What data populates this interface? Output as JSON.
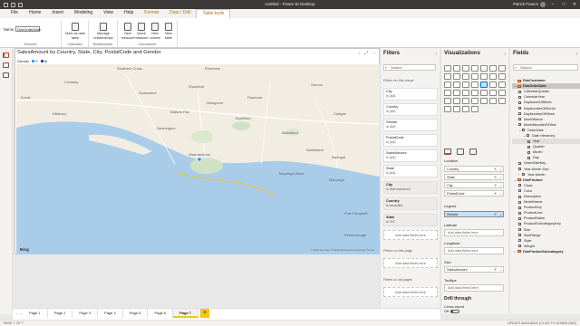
{
  "window": {
    "title": "Untitled - Power BI Desktop",
    "user": "Patrick Powers"
  },
  "menu": {
    "file": "File",
    "home": "Home",
    "insert": "Insert",
    "modeling": "Modeling",
    "view": "View",
    "help": "Help",
    "format": "Format",
    "data_drill": "Data / Drill",
    "table_tools": "Table tools"
  },
  "ribbon": {
    "name_label": "Name",
    "name_value": "DimOrderDate",
    "group_structure": "Structure",
    "mark_date_line1": "Mark as date",
    "mark_date_line2": "table",
    "group_calendars": "Calendars",
    "manage_line1": "Manage",
    "manage_line2": "relationships",
    "group_relationships": "Relationships",
    "new_measure_line1": "New",
    "new_measure_line2": "measure",
    "quick_measure_line1": "Quick",
    "quick_measure_line2": "measure",
    "new_column_line1": "New",
    "new_column_line2": "column",
    "new_table_line1": "New",
    "new_table_line2": "table",
    "group_calculations": "Calculations"
  },
  "visual": {
    "title": "SalesAmount by Country, State, City, PostalCode and Gender",
    "legend_title": "Gender",
    "legend": [
      {
        "label": "F",
        "color": "#118dff"
      },
      {
        "label": "M",
        "color": "#12239e"
      }
    ],
    "places": [
      "Southern Cross",
      "Pyrenees",
      "Crossley",
      "Koroit",
      "Killarney",
      "Grassmere",
      "Woodford",
      "Mailors Flat",
      "Panmure",
      "Garvoc",
      "Cudgee",
      "Allansford",
      "Dennington",
      "Warrnambool",
      "Bushfield",
      "Nullawarre",
      "Mepunga West",
      "Mepunga",
      "Port Campbell",
      "Peterborough",
      "Naringal",
      "Wangoom"
    ],
    "bing": "Bing",
    "copyright": "© 2022 TomTom © 2022 Microsoft Corporation  Terms"
  },
  "filters": {
    "title": "Filters",
    "search_placeholder": "Search",
    "section_visual": "Filters on this visual",
    "cards": [
      {
        "name": "City",
        "value": "is (All)"
      },
      {
        "name": "Country",
        "value": "is (All)"
      },
      {
        "name": "Gender",
        "value": "is (All)"
      },
      {
        "name": "PostalCode",
        "value": "is (All)"
      },
      {
        "name": "SalesAmount",
        "value": "is (All)"
      },
      {
        "name": "State",
        "value": "is (All)"
      },
      {
        "name": "City",
        "value": "is Warrnambool"
      },
      {
        "name": "Country",
        "value": "is Australia"
      },
      {
        "name": "State",
        "value": "is VIC"
      }
    ],
    "add_data": "Add data fields here",
    "section_page": "Filters on this page",
    "section_all": "Filters on all pages"
  },
  "viz": {
    "title": "Visualizations",
    "location_label": "Location",
    "location_items": [
      "Country",
      "State",
      "City",
      "PostalCode"
    ],
    "legend_label": "Legend",
    "legend_item": "Gender",
    "latitude_label": "Latitude",
    "longitude_label": "Longitude",
    "size_label": "Size",
    "size_item": "SalesAmount",
    "tooltips_label": "Tooltips",
    "add_data": "Add data fields here",
    "drill_title": "Drill through",
    "cross_report": "Cross-report",
    "cross_state": "Off",
    "keep_filters": "Keep all filters",
    "keep_state": "On",
    "add_drill": "Add drill-through fields here"
  },
  "fields": {
    "title": "Fields",
    "search_placeholder": "Search",
    "tree": [
      {
        "label": "DimCustomer",
        "type": "table",
        "indent": 0,
        "chev": "›"
      },
      {
        "label": "DimOrderDate",
        "type": "table",
        "indent": 0,
        "chev": "⌄",
        "hl": true
      },
      {
        "label": "CalendarQuarter",
        "type": "field",
        "indent": 1
      },
      {
        "label": "CalendarYear",
        "type": "field",
        "indent": 1
      },
      {
        "label": "DayNameOfWeek",
        "type": "field",
        "indent": 1
      },
      {
        "label": "DayNumberOfMonth",
        "type": "field",
        "indent": 1
      },
      {
        "label": "DayNumberOfWeek",
        "type": "field",
        "indent": 1
      },
      {
        "label": "MonthName",
        "type": "field",
        "indent": 1
      },
      {
        "label": "MonthNumberOfYear",
        "type": "field",
        "indent": 1
      },
      {
        "label": "OrderDate",
        "type": "group",
        "indent": 1,
        "chev": "⌄"
      },
      {
        "label": "Date Hierarchy",
        "type": "group",
        "indent": 2,
        "chev": "⌄"
      },
      {
        "label": "Year",
        "type": "field",
        "indent": 3,
        "hover": true
      },
      {
        "label": "Quarter",
        "type": "field",
        "indent": 3
      },
      {
        "label": "Month",
        "type": "field",
        "indent": 3
      },
      {
        "label": "Day",
        "type": "field",
        "indent": 3
      },
      {
        "label": "OrderDateKey",
        "type": "field",
        "indent": 1
      },
      {
        "label": "Year-Month Sort",
        "type": "field",
        "indent": 1
      },
      {
        "label": "Year-Month",
        "type": "group",
        "indent": 1,
        "chev": "›"
      },
      {
        "label": "DimProduct",
        "type": "table",
        "indent": 0,
        "chev": "⌄"
      },
      {
        "label": "Class",
        "type": "field",
        "indent": 1
      },
      {
        "label": "Color",
        "type": "field",
        "indent": 1
      },
      {
        "label": "Description",
        "type": "field",
        "indent": 1
      },
      {
        "label": "ModelName",
        "type": "field",
        "indent": 1
      },
      {
        "label": "ProductKey",
        "type": "field",
        "indent": 1
      },
      {
        "label": "ProductLine",
        "type": "field",
        "indent": 1
      },
      {
        "label": "ProductName",
        "type": "field",
        "indent": 1
      },
      {
        "label": "ProductSubcategoryKey",
        "type": "field",
        "indent": 1
      },
      {
        "label": "Size",
        "type": "field",
        "indent": 1
      },
      {
        "label": "SizeRange",
        "type": "field",
        "indent": 1
      },
      {
        "label": "Style",
        "type": "field",
        "indent": 1
      },
      {
        "label": "Weight",
        "type": "field",
        "indent": 1
      },
      {
        "label": "DimProductSubcategory",
        "type": "table",
        "indent": 0,
        "chev": "›"
      }
    ]
  },
  "pages": [
    "Page 1",
    "Page 2",
    "Page 3",
    "Page 4",
    "Page 5",
    "Page 6",
    "Page 7"
  ],
  "active_page": "Page 7",
  "status": {
    "left": "PAGE 7 OF 7",
    "right": "UPDATE AVAILABLE (CLICK TO DOWNLOAD)"
  }
}
